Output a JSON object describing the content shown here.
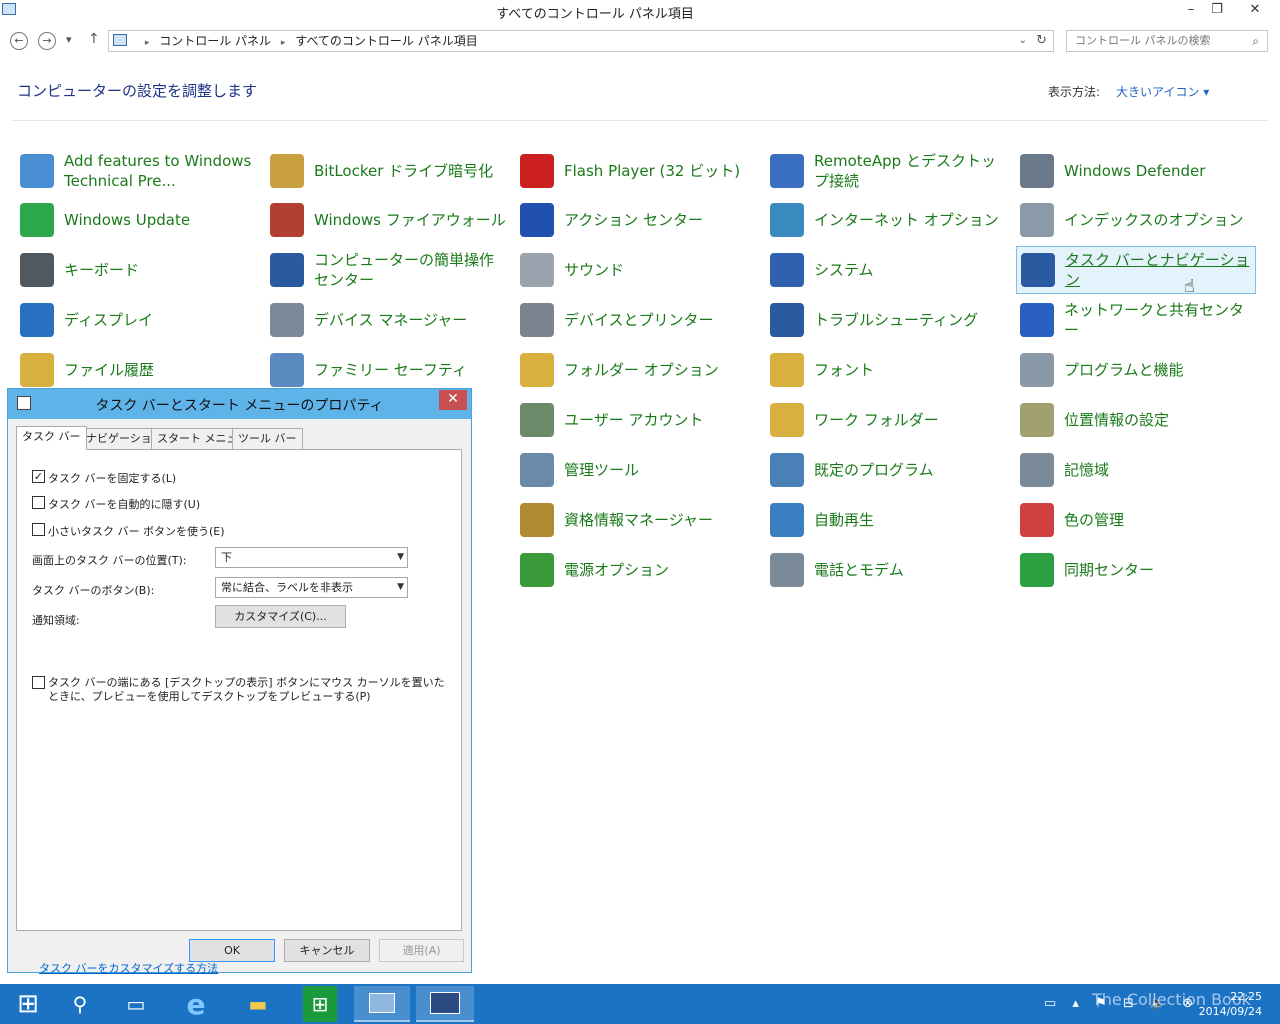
{
  "window": {
    "title": "すべてのコントロール パネル項目",
    "minimize": "–",
    "restore": "❐",
    "close": "✕"
  },
  "nav": {
    "back": "←",
    "forward": "→",
    "recent": "▾",
    "up": "↑"
  },
  "address": {
    "crumbs": [
      "コントロール パネル",
      "すべてのコントロール パネル項目"
    ],
    "dropdown": "⌄",
    "refresh": "↻"
  },
  "search": {
    "placeholder": "コントロール パネルの検索",
    "icon": "⌕"
  },
  "heading": "コンピューターの設定を調整します",
  "view": {
    "label": "表示方法:",
    "value": "大きいアイコン ▾"
  },
  "items": [
    [
      "Add features to Windows Technical Pre...",
      "BitLocker ドライブ暗号化",
      "Flash Player (32 ビット)",
      "RemoteApp とデスクトップ接続",
      "Windows Defender"
    ],
    [
      "Windows Update",
      "Windows ファイアウォール",
      "アクション センター",
      "インターネット オプション",
      "インデックスのオプション"
    ],
    [
      "キーボード",
      "コンピューターの簡単操作センター",
      "サウンド",
      "システム",
      "タスク バーとナビゲーション"
    ],
    [
      "ディスプレイ",
      "デバイス マネージャー",
      "デバイスとプリンター",
      "トラブルシューティング",
      "ネットワークと共有センター"
    ],
    [
      "ファイル履歴",
      "ファミリー セーフティ",
      "フォルダー オプション",
      "フォント",
      "プログラムと機能"
    ],
    [
      "",
      "",
      "ユーザー アカウント",
      "ワーク フォルダー",
      "位置情報の設定"
    ],
    [
      "",
      "",
      "管理ツール",
      "既定のプログラム",
      "記憶域"
    ],
    [
      "",
      "",
      "資格情報マネージャー",
      "自動再生",
      "色の管理"
    ],
    [
      "",
      "",
      "電源オプション",
      "電話とモデム",
      "同期センター"
    ]
  ],
  "item_colors": [
    [
      "#4a8fd4",
      "#c8a040",
      "#cc2020",
      "#3a6ec0",
      "#6a7a8a"
    ],
    [
      "#2aa84a",
      "#b04030",
      "#2050b0",
      "#3a8ac0",
      "#8a9aa8"
    ],
    [
      "#505860",
      "#2a5aa0",
      "#9aa4ae",
      "#3060b0",
      "#2a5aa0"
    ],
    [
      "#2a70c0",
      "#7a8a98",
      "#7a8590",
      "#2a5aa0",
      "#2a60c0"
    ],
    [
      "#d8b040",
      "#5a8ac0",
      "#d8b040",
      "#d8b040",
      "#8a98a8"
    ],
    [
      "",
      "",
      "#6a8a6a",
      "#d8b040",
      "#a0a070"
    ],
    [
      "",
      "",
      "#6a8aa8",
      "#4a80b8",
      "#7a8a98"
    ],
    [
      "",
      "",
      "#b08a30",
      "#3a80c0",
      "#d04040"
    ],
    [
      "",
      "",
      "#3a9a3a",
      "#7a8a98",
      "#2aa040"
    ]
  ],
  "dialog": {
    "title": "タスク バーとスタート メニューのプロパティ",
    "close": "✕",
    "tabs": [
      "タスク バー",
      "ナビゲーション",
      "スタート メニュー",
      "ツール バー"
    ],
    "lock": {
      "label": "タスク バーを固定する(L)",
      "mark": "✓"
    },
    "autohide": "タスク バーを自動的に隠す(U)",
    "small": "小さいタスク バー ボタンを使う(E)",
    "position": {
      "label": "画面上のタスク バーの位置(T):",
      "value": "下"
    },
    "buttons": {
      "label": "タスク バーのボタン(B):",
      "value": "常に結合、ラベルを非表示"
    },
    "notify": {
      "label": "通知領域:",
      "button": "カスタマイズ(C)..."
    },
    "peek": "タスク バーの端にある [デスクトップの表示] ボタンにマウス カーソルを置いたときに、プレビューを使用してデスクトップをプレビューする(P)",
    "help": "タスク バーをカスタマイズする方法",
    "ok": "OK",
    "cancel": "キャンセル",
    "apply": "適用(A)"
  },
  "taskbar": {
    "start": "⊞",
    "search": "⚲",
    "taskview": "▭",
    "ie": "e",
    "explorer": "▬",
    "store": "⊞",
    "tray": "▭ ▴ ⚑ ⊟ 🔈 ⊗",
    "time": "22:25",
    "date": "2014/09/24"
  },
  "watermark": "The Collection Book",
  "cursor": "☝"
}
